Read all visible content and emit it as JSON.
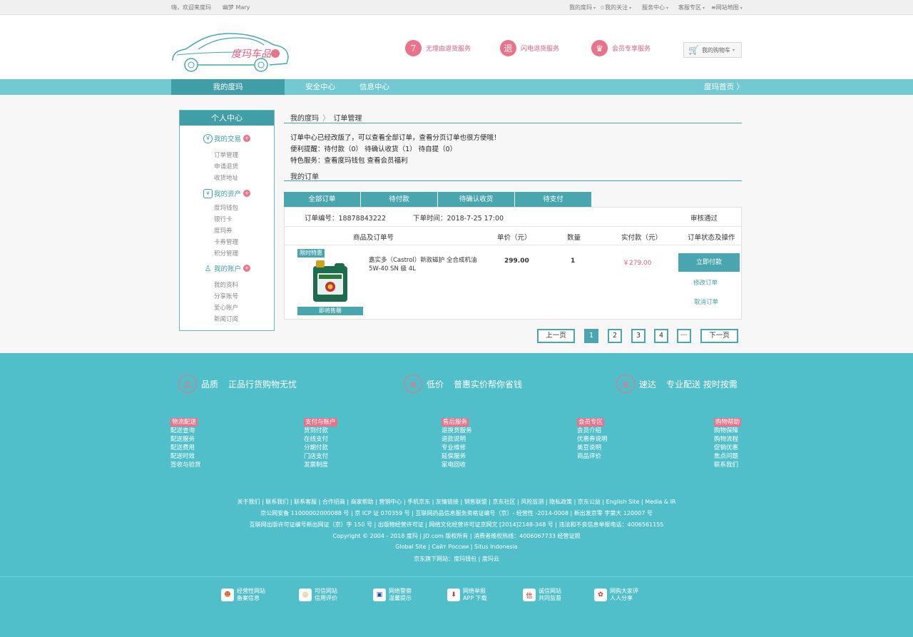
{
  "topbar": {
    "greeting": "嗨，欢迎来度玛",
    "user": "幽梦 Mary",
    "links": [
      "我的度玛",
      "☆我的关注",
      "服务中心",
      "客服专区",
      "≡网站地图"
    ]
  },
  "header": {
    "logo_text": "度玛车品",
    "services": [
      {
        "badge": "7",
        "label": "无理由退货服务"
      },
      {
        "badge": "退",
        "label": "闪电退货服务"
      },
      {
        "badge": "♛",
        "label": "会员专享服务"
      }
    ],
    "cart_label": "我的购物车"
  },
  "nav": {
    "items": [
      "我的度玛",
      "安全中心",
      "信息中心"
    ],
    "home_link": "度玛首页 〉"
  },
  "sidebar": {
    "title": "个人中心",
    "groups": [
      {
        "icon": "¥",
        "title": "我的交易",
        "items": [
          "订单管理",
          "申请退货",
          "收货地址"
        ]
      },
      {
        "icon": "¥",
        "title": "我的资产",
        "items": [
          "度玛钱包",
          "银行卡",
          "度玛券",
          "卡券管理",
          "积分管理"
        ]
      },
      {
        "icon": "♙",
        "title": "我的账户",
        "items": [
          "我的资料",
          "分享账号",
          "爱心账户",
          "新闻订阅"
        ]
      }
    ]
  },
  "main": {
    "breadcrumb": [
      "我的度玛",
      "订单管理"
    ],
    "notice": "订单中心已经改版了，可以查看全部订单，查看分页订单也很方便哦！",
    "reminder": "便利提醒：待付款（0）  待确认收货（1）  待自提（0）",
    "special": "特色服务：查看度玛钱包    查看会员福利",
    "orders_title": "我的订单",
    "tabs": [
      "全部订单",
      "待付款",
      "待确认收货",
      "待支付"
    ],
    "order": {
      "number": "订单编号：18878843222",
      "time": "下单时间：2018-7-25  17:00",
      "status": "审核通过",
      "headers": [
        "商品及订单号",
        "单价（元）",
        "数量",
        "实付款（元）",
        "订单状态及操作"
      ],
      "product_badge": "限时特惠",
      "product_caption": "即将售罄",
      "product_name_1": "嘉实多（Castrol）新款磁护 全合成机油",
      "product_name_2": "5W-40 SN 级 4L",
      "unit_price": "299.00",
      "quantity": "1",
      "paid": "￥279.00",
      "pay_button": "立即付款",
      "modify": "修改订单",
      "cancel": "取消订单"
    },
    "pagination": {
      "prev": "上一页",
      "pages": [
        "1",
        "2",
        "3",
        "4",
        "···"
      ],
      "next": "下一页"
    }
  },
  "footer": {
    "features": [
      {
        "icon": "品",
        "title": "品质",
        "desc": "正品行货购物无忧"
      },
      {
        "icon": "廉",
        "title": "低价",
        "desc": "普惠实价帮你省钱"
      },
      {
        "icon": "速",
        "title": "速达",
        "desc": "专业配送 按时按需"
      }
    ],
    "columns": [
      {
        "title": "物流配送",
        "items": [
          "配送查询",
          "配送服务",
          "配送费用",
          "配送时效",
          "签收与验货"
        ]
      },
      {
        "title": "支付与账户",
        "items": [
          "货到付款",
          "在线支付",
          "分期付款",
          "门店支付",
          "发票制度"
        ]
      },
      {
        "title": "售后服务",
        "items": [
          "退换货服务",
          "退款说明",
          "专业维修",
          "延保服务",
          "家电回收"
        ]
      },
      {
        "title": "会员专区",
        "items": [
          "会员介绍",
          "优惠券说明",
          "美豆说明",
          "商品评价"
        ]
      },
      {
        "title": "购物帮助",
        "items": [
          "购物保障",
          "购物流程",
          "促销优惠",
          "焦点问题",
          "联系我们"
        ]
      }
    ],
    "links_line": "关于我们 | 联系我们 | 联系客服 | 合作招商 | 商家帮助 | 营销中心 | 手机京东 | 友情链接 | 销售联盟 | 京东社区 | 风险监测 | 隐私政策 | 京东公益 | English Site | Media & IR",
    "lines": [
      "京公网安备 11000002000088 号 | 京 ICP 证 070359 号 | 互联网药品信息服务资格证编号（京）- 经营性 -2014-0008 | 新出发京零 字第大 120007 号",
      "互联网出版许可证编号新出网证（京）字 150 号 | 出版物经营许可证 | 网络文化经营许可证京网文 [2014]2148-348 号 | 违法和不良信息举报电话：4006561155",
      "Copyright © 2004 - 2018  度玛 | JD.com 版权所有 | 消费者维权热线：4006067733 经营证照",
      "Global Site   |   Сайт России   |   Situs Indonesia",
      "京东旗下网站：度玛钱包  |  度玛云"
    ],
    "certs": [
      {
        "icon": "☻",
        "line1": "经营性网站",
        "line2": "备案信息",
        "color": "#e05a2a"
      },
      {
        "icon": "◎",
        "line1": "可信网站",
        "line2": "信用评价",
        "color": "#e08a20"
      },
      {
        "icon": "▣",
        "line1": "网络警察",
        "line2": "温馨提示",
        "color": "#2a4aa0"
      },
      {
        "icon": "⬇",
        "line1": "网络举报",
        "line2": "APP 下载",
        "color": "#d02a2a"
      },
      {
        "icon": "信",
        "line1": "诚信网站",
        "line2": "共同监督",
        "color": "#d02a2a"
      },
      {
        "icon": "✿",
        "line1": "网购大家评",
        "line2": "人人分享",
        "color": "#d02a2a"
      }
    ]
  }
}
